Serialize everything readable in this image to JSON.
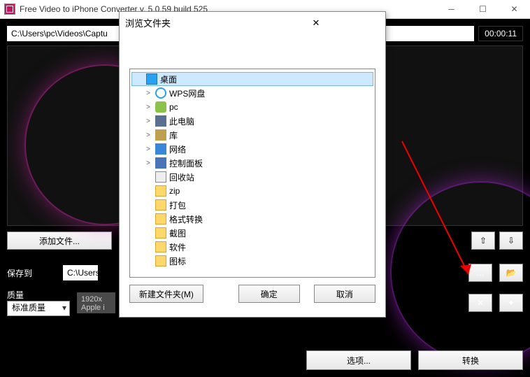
{
  "window": {
    "title": "Free Video to iPhone Converter  v. 5.0.59 build 525"
  },
  "main": {
    "path": "C:\\Users\\pc\\Videos\\Captu",
    "duration": "00:00:11",
    "add_files": "添加文件...",
    "save_to_label": "保存到",
    "save_to_path": "C:\\Users",
    "quality_label": "质量",
    "quality_value": "标准质量",
    "format_info": "1920x\nApple i",
    "options_btn": "选项...",
    "convert_btn": "转换"
  },
  "dialog": {
    "title": "浏览文件夹",
    "new_folder": "新建文件夹(M)",
    "ok": "确定",
    "cancel": "取消",
    "tree": [
      {
        "label": "桌面",
        "icon": "desktop",
        "selected": true,
        "expander": ""
      },
      {
        "label": "WPS网盘",
        "icon": "cloud",
        "expander": ">"
      },
      {
        "label": "pc",
        "icon": "user",
        "expander": ">"
      },
      {
        "label": "此电脑",
        "icon": "pc",
        "expander": ">"
      },
      {
        "label": "库",
        "icon": "lib",
        "expander": ">"
      },
      {
        "label": "网络",
        "icon": "net",
        "expander": ">"
      },
      {
        "label": "控制面板",
        "icon": "ctrl",
        "expander": ">"
      },
      {
        "label": "回收站",
        "icon": "recycle",
        "expander": ""
      },
      {
        "label": "zip",
        "icon": "folder",
        "expander": ""
      },
      {
        "label": "打包",
        "icon": "folder",
        "expander": ""
      },
      {
        "label": "格式转换",
        "icon": "folder",
        "expander": ""
      },
      {
        "label": "截图",
        "icon": "folder",
        "expander": ""
      },
      {
        "label": "软件",
        "icon": "folder",
        "expander": ""
      },
      {
        "label": "图标",
        "icon": "folder",
        "expander": ""
      }
    ]
  }
}
